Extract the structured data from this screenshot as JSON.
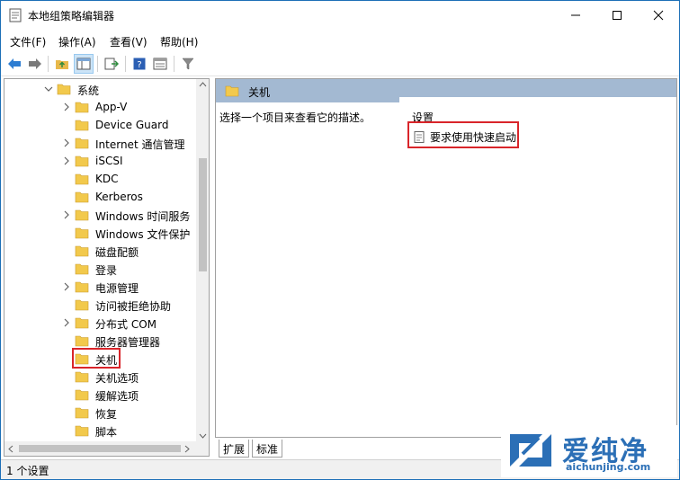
{
  "window": {
    "title": "本地组策略编辑器"
  },
  "menu": [
    "文件(F)",
    "操作(A)",
    "查看(V)",
    "帮助(H)"
  ],
  "toolbar": {
    "buttons": [
      "back-icon",
      "forward-icon",
      "up-folder-icon",
      "show-hide-tree-icon",
      "export-list-icon",
      "help-icon",
      "properties-icon",
      "filter-icon"
    ]
  },
  "tree": {
    "items": [
      {
        "label": "系统",
        "expandable": true,
        "expanded": true
      },
      {
        "label": "App-V",
        "expandable": true
      },
      {
        "label": "Device Guard",
        "expandable": false
      },
      {
        "label": "Internet 通信管理",
        "expandable": true
      },
      {
        "label": "iSCSI",
        "expandable": true
      },
      {
        "label": "KDC",
        "expandable": false
      },
      {
        "label": "Kerberos",
        "expandable": false
      },
      {
        "label": "Windows 时间服务",
        "expandable": true
      },
      {
        "label": "Windows 文件保护",
        "expandable": false
      },
      {
        "label": "磁盘配额",
        "expandable": false
      },
      {
        "label": "登录",
        "expandable": false
      },
      {
        "label": "电源管理",
        "expandable": true
      },
      {
        "label": "访问被拒绝协助",
        "expandable": false
      },
      {
        "label": "分布式 COM",
        "expandable": true
      },
      {
        "label": "服务器管理器",
        "expandable": false
      },
      {
        "label": "关机",
        "expandable": false,
        "selected": true
      },
      {
        "label": "关机选项",
        "expandable": false
      },
      {
        "label": "缓解选项",
        "expandable": false
      },
      {
        "label": "恢复",
        "expandable": false
      },
      {
        "label": "脚本",
        "expandable": false
      }
    ]
  },
  "right": {
    "header": "关机",
    "description": "选择一个项目来查看它的描述。",
    "column_header": "设置",
    "settings": [
      "要求使用快速启动"
    ]
  },
  "tabs": [
    "扩展",
    "标准"
  ],
  "status": "1 个设置",
  "watermark": {
    "cn": "爱纯净",
    "en": "aichunjing.com"
  },
  "colors": {
    "header_bg": "#a3b9d2",
    "highlight": "#d9252a",
    "folder": "#f2c94c",
    "accent": "#2b6fb6"
  }
}
